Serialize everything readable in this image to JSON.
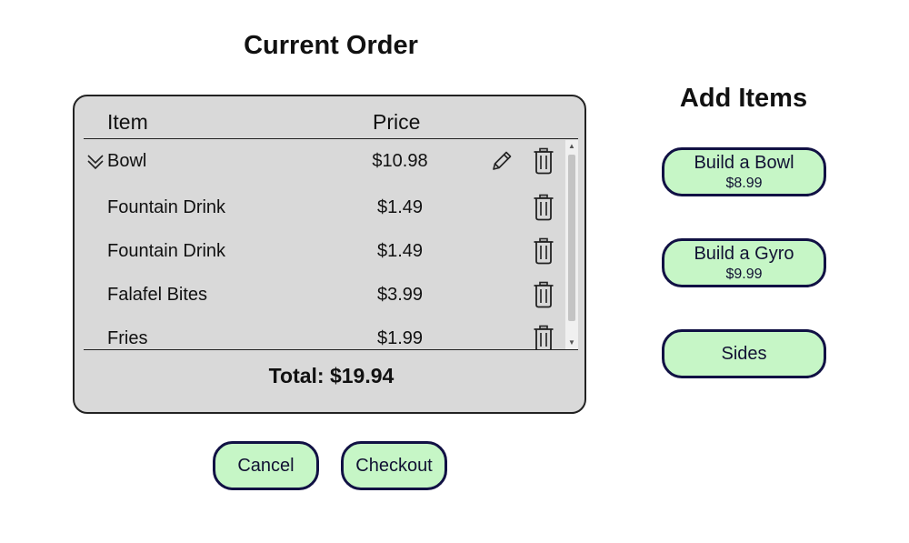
{
  "order": {
    "title": "Current Order",
    "columns": {
      "item": "Item",
      "price": "Price"
    },
    "items": [
      {
        "name": "Bowl",
        "price": "$10.98",
        "expandable": true,
        "editable": true
      },
      {
        "name": "Fountain Drink",
        "price": "$1.49",
        "expandable": false,
        "editable": false
      },
      {
        "name": "Fountain Drink",
        "price": "$1.49",
        "expandable": false,
        "editable": false
      },
      {
        "name": "Falafel Bites",
        "price": "$3.99",
        "expandable": false,
        "editable": false
      },
      {
        "name": "Fries",
        "price": "$1.99",
        "expandable": false,
        "editable": false
      }
    ],
    "total": "Total: $19.94"
  },
  "add_items": {
    "title": "Add Items",
    "buttons": [
      {
        "label": "Build a Bowl",
        "price": "$8.99"
      },
      {
        "label": "Build a Gyro",
        "price": "$9.99"
      },
      {
        "label": "Sides"
      }
    ]
  },
  "actions": {
    "cancel": "Cancel",
    "checkout": "Checkout"
  },
  "icons": {
    "expand": "chevron-double-down-icon",
    "edit": "pencil-icon",
    "delete": "trash-icon"
  },
  "colors": {
    "panel_bg": "#d9d9d9",
    "button_bg": "#c6f6c6",
    "button_border": "#111144"
  }
}
